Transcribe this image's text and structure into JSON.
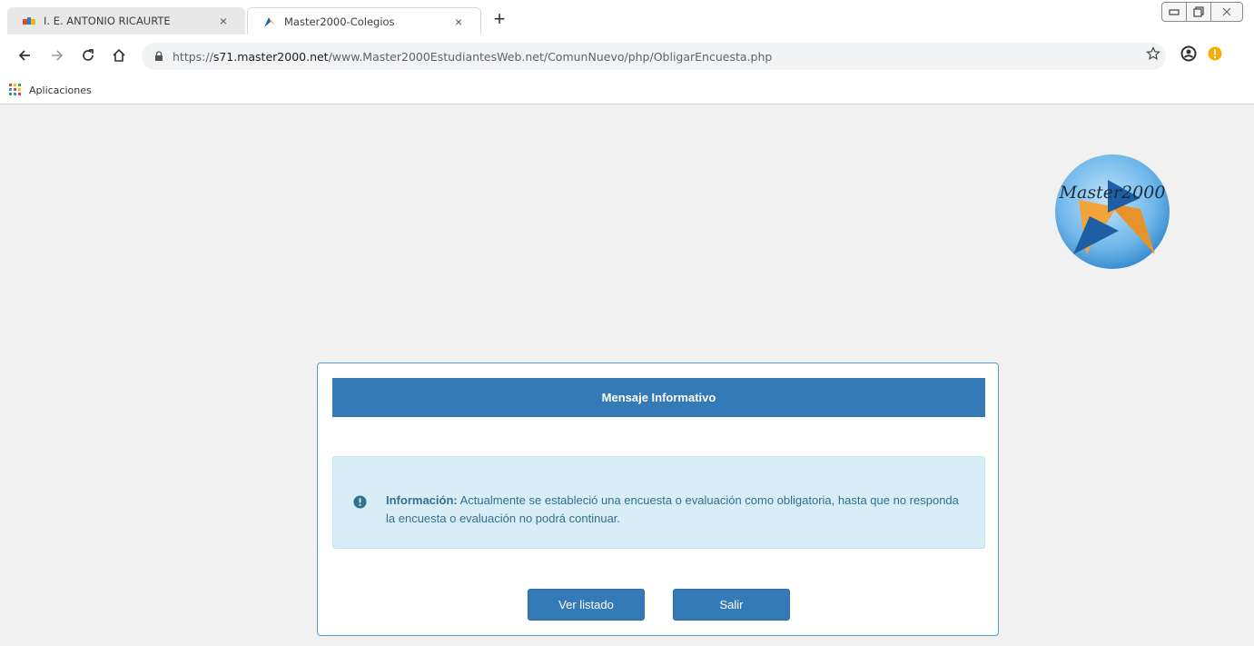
{
  "browser": {
    "tabs": [
      {
        "title": "I. E. ANTONIO RICAURTE",
        "close": "×",
        "active": false
      },
      {
        "title": "Master2000-Colegios",
        "close": "×",
        "active": true
      }
    ],
    "new_tab": "+",
    "url": {
      "scheme": "https://",
      "host": "s71.master2000.net",
      "path": "/www.Master2000EstudiantesWeb.net/ComunNuevo/php/ObligarEncuesta.php"
    },
    "bookmarks": [
      {
        "label": "Aplicaciones",
        "icon": "apps-grid-icon"
      }
    ]
  },
  "logo": {
    "text": "Master2000"
  },
  "dialog": {
    "title": "Mensaje Informativo",
    "alert_label": "Información:",
    "alert_text": " Actualmente se estableció una encuesta o evaluación como obligatoria, hasta que no responda la encuesta o evaluación no podrá continuar.",
    "buttons": {
      "list": "Ver listado",
      "exit": "Salir"
    }
  },
  "colors": {
    "primary": "#337ab7",
    "alert_bg": "#d9edf7",
    "alert_text": "#31708f",
    "page_bg": "#f1f1f1",
    "warning_badge": "#f9ab00"
  }
}
